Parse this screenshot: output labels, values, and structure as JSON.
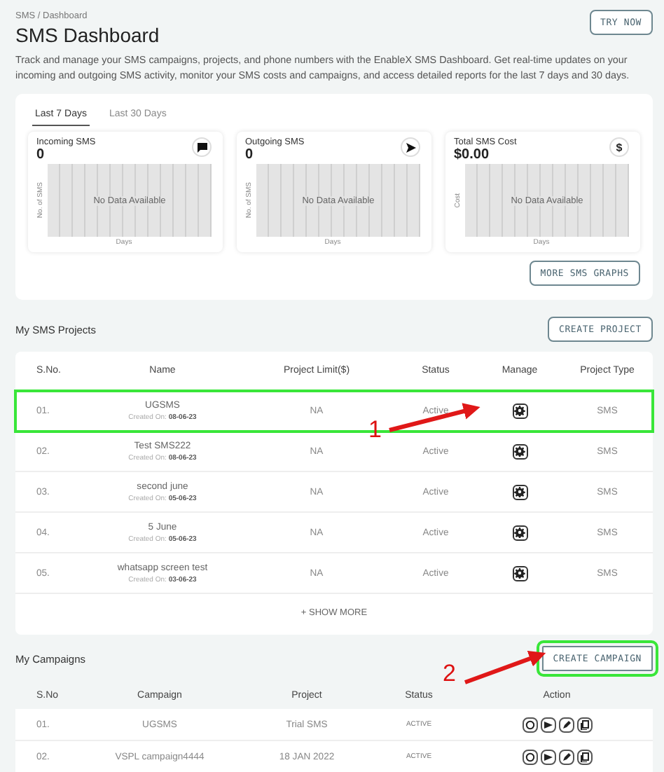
{
  "breadcrumb": "SMS / Dashboard",
  "title": "SMS Dashboard",
  "try_button": "TRY NOW",
  "description": "Track and manage your SMS campaigns, projects, and phone numbers with the EnableX SMS Dashboard. Get real-time updates on your incoming and outgoing SMS activity, monitor your SMS costs and campaigns, and access detailed reports for the last 7 days and 30 days.",
  "tabs": [
    {
      "label": "Last 7 Days",
      "selected": true
    },
    {
      "label": "Last 30 Days",
      "selected": false
    }
  ],
  "stats": [
    {
      "label": "Incoming SMS",
      "value": "0",
      "kind": "chat",
      "ylabel": "No. of SMS",
      "empty": "No Data Available",
      "xlabel": "Days"
    },
    {
      "label": "Outgoing SMS",
      "value": "0",
      "kind": "send",
      "ylabel": "No. of SMS",
      "empty": "No Data Available",
      "xlabel": "Days"
    },
    {
      "label": "Total SMS Cost",
      "value": "$0.00",
      "kind": "glyph",
      "glyph": "$",
      "ylabel": "Cost",
      "empty": "No Data Available",
      "xlabel": "Days"
    }
  ],
  "more_graphs": "MORE SMS GRAPHS",
  "projects": {
    "title": "My SMS Projects",
    "create": "CREATE PROJECT",
    "columns": [
      "S.No.",
      "Name",
      "Project Limit($)",
      "Status",
      "Manage",
      "Project Type"
    ],
    "rows": [
      {
        "no": "01.",
        "name": "UGSMS",
        "created_label": "Created On:",
        "created": "08-06-23",
        "limit": "NA",
        "status": "Active",
        "type": "SMS",
        "highlighted": true
      },
      {
        "no": "02.",
        "name": "Test SMS222",
        "created_label": "Created On:",
        "created": "08-06-23",
        "limit": "NA",
        "status": "Active",
        "type": "SMS",
        "highlighted": false
      },
      {
        "no": "03.",
        "name": "second june",
        "created_label": "Created On:",
        "created": "05-06-23",
        "limit": "NA",
        "status": "Active",
        "type": "SMS",
        "highlighted": false
      },
      {
        "no": "04.",
        "name": "5 June",
        "created_label": "Created On:",
        "created": "05-06-23",
        "limit": "NA",
        "status": "Active",
        "type": "SMS",
        "highlighted": false
      },
      {
        "no": "05.",
        "name": "whatsapp screen test",
        "created_label": "Created On:",
        "created": "03-06-23",
        "limit": "NA",
        "status": "Active",
        "type": "SMS",
        "highlighted": false
      }
    ],
    "show_more": "+ SHOW MORE"
  },
  "campaigns": {
    "title": "My Campaigns",
    "create": "CREATE CAMPAIGN",
    "create_highlighted": true,
    "columns": [
      "S.No",
      "Campaign",
      "Project",
      "Status",
      "Action"
    ],
    "rows": [
      {
        "no": "01.",
        "campaign": "UGSMS",
        "project": "Trial SMS",
        "status": "ACTIVE"
      },
      {
        "no": "02.",
        "campaign": "VSPL campaign4444",
        "project": "18 JAN 2022",
        "status": "ACTIVE"
      }
    ]
  },
  "annotations": [
    {
      "label": "1"
    },
    {
      "label": "2"
    }
  ]
}
